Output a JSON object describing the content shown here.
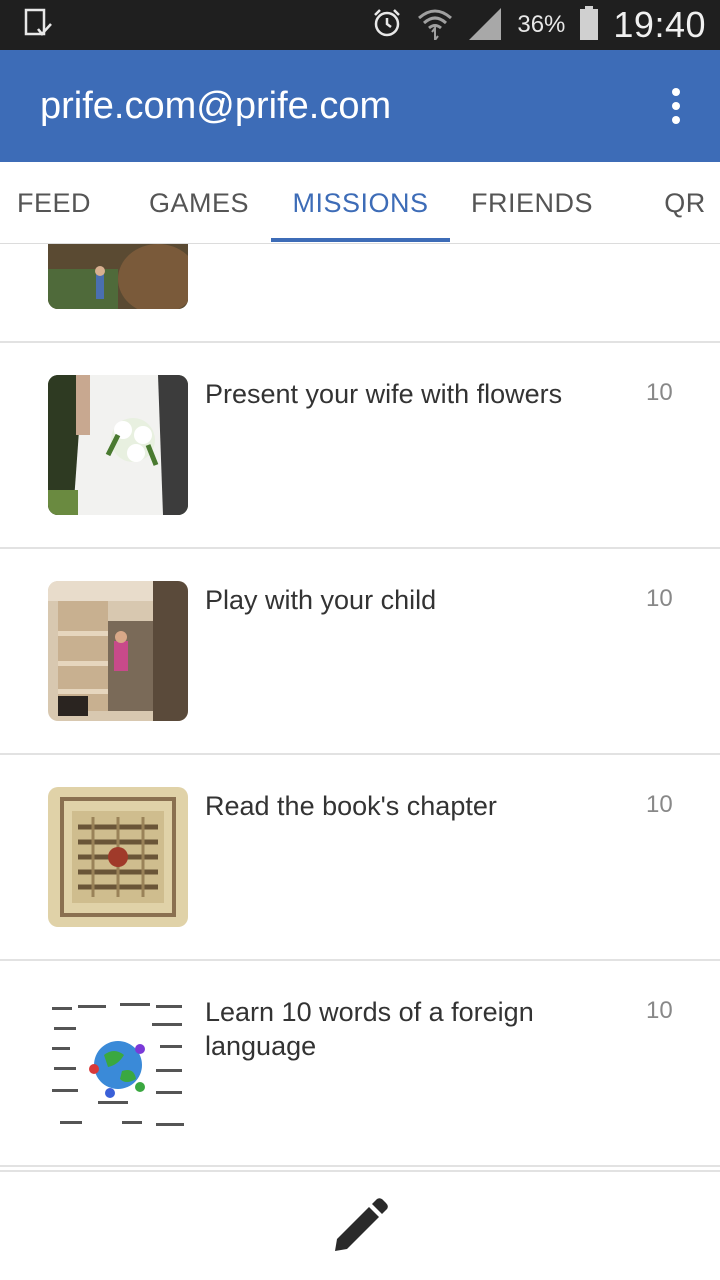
{
  "status_bar": {
    "battery_percent": "36%",
    "time": "19:40",
    "icons": [
      "device-check-icon",
      "alarm-icon",
      "wifi-icon",
      "signal-icon",
      "battery-icon"
    ]
  },
  "app_bar": {
    "title": "prife.com@prife.com",
    "color": "#3d6cb7",
    "menu_icon": "overflow-menu-icon"
  },
  "tabs": {
    "items": [
      {
        "label": "FEED"
      },
      {
        "label": "GAMES"
      },
      {
        "label": "MISSIONS"
      },
      {
        "label": "FRIENDS"
      },
      {
        "label": "QR"
      }
    ],
    "active": "MISSIONS"
  },
  "missions": [
    {
      "title": "",
      "points": "",
      "image": "tree-photo"
    },
    {
      "title": "Present your wife with flowers",
      "points": "10",
      "image": "bride-bouquet-photo"
    },
    {
      "title": "Play with your child",
      "points": "10",
      "image": "child-in-doorway-photo"
    },
    {
      "title": "Read the book's chapter",
      "points": "10",
      "image": "illuminated-manuscript-photo"
    },
    {
      "title": "Learn 10 words of a foreign language",
      "points": "10",
      "image": "globe-words-image"
    }
  ],
  "bottom_bar": {
    "action_icon": "edit-pencil-icon"
  }
}
